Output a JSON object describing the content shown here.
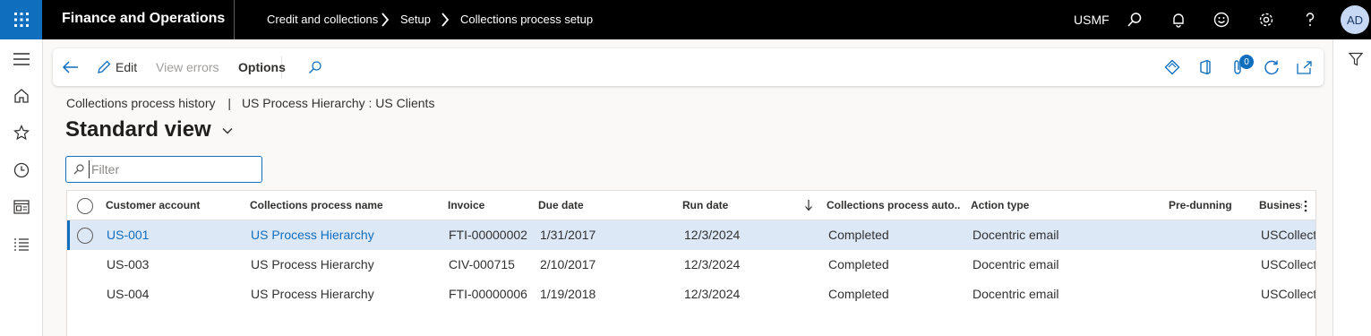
{
  "topbar": {
    "app_title": "Finance and Operations",
    "breadcrumbs": [
      "Credit and collections",
      "Setup",
      "Collections process setup"
    ],
    "company": "USMF",
    "avatar_initials": "AD"
  },
  "actionpane": {
    "edit": "Edit",
    "view_errors": "View errors",
    "options": "Options",
    "attachments_count": "0"
  },
  "header": {
    "breadcrumb_left": "Collections process history",
    "breadcrumb_sep": "|",
    "breadcrumb_right": "US Process Hierarchy : US Clients",
    "view_title": "Standard view"
  },
  "filter": {
    "placeholder": "Filter"
  },
  "grid": {
    "columns": [
      "Customer account",
      "Collections process name",
      "Invoice",
      "Due date",
      "Run date",
      "Collections process auto...",
      "Action type",
      "Pre-dunning",
      "Business"
    ],
    "rows": [
      [
        "US-001",
        "US Process Hierarchy",
        "FTI-00000002",
        "1/31/2017",
        "12/3/2024",
        "Completed",
        "Docentric email",
        "",
        "USCollect"
      ],
      [
        "US-003",
        "US Process Hierarchy",
        "CIV-000715",
        "2/10/2017",
        "12/3/2024",
        "Completed",
        "Docentric email",
        "",
        "USCollect"
      ],
      [
        "US-004",
        "US Process Hierarchy",
        "FTI-00000006",
        "1/19/2018",
        "12/3/2024",
        "Completed",
        "Docentric email",
        "",
        "USCollect"
      ]
    ]
  },
  "colors": {
    "accent": "#106ebe",
    "selected_row": "#dde8f7",
    "topbar": "#000000"
  }
}
